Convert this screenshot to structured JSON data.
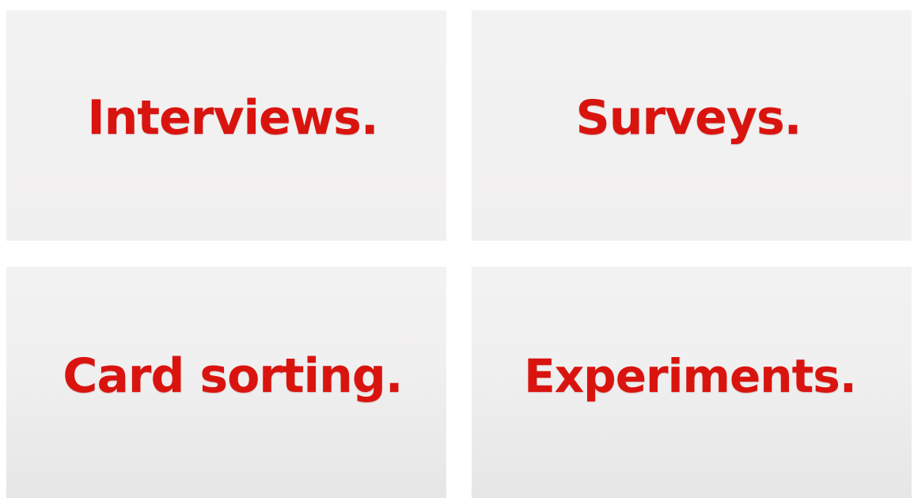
{
  "tiles": [
    {
      "label": "Interviews."
    },
    {
      "label": "Surveys."
    },
    {
      "label": "Card sorting."
    },
    {
      "label": "Experiments."
    }
  ]
}
